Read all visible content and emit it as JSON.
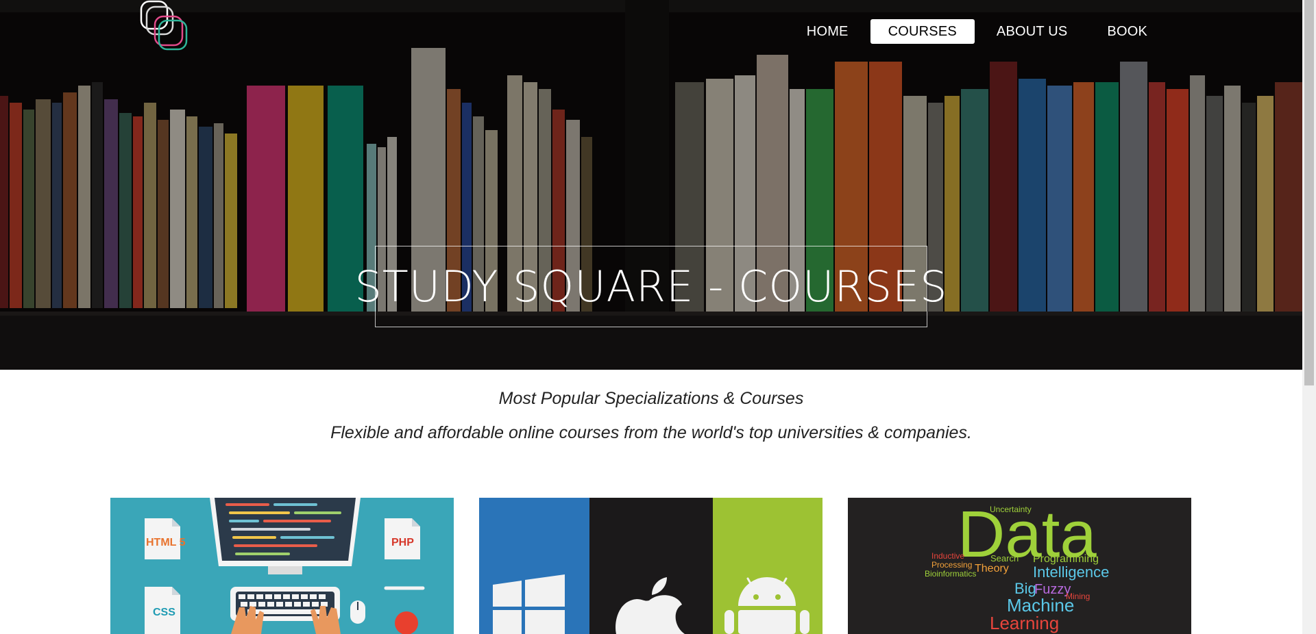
{
  "nav": {
    "items": [
      {
        "label": "HOME",
        "active": false
      },
      {
        "label": "COURSES",
        "active": true
      },
      {
        "label": "ABOUT US",
        "active": false
      },
      {
        "label": "BOOK",
        "active": false
      }
    ]
  },
  "hero": {
    "title": "STUDY SQUARE - COURSES"
  },
  "intro": {
    "line1": "Most Popular Specializations & Courses",
    "line2": "Flexible and affordable online courses from the world's top universities & companies."
  },
  "cards": {
    "web": {
      "labels": [
        "HTML 5",
        "PHP",
        "CSS"
      ]
    },
    "data": {
      "big_word": "Data",
      "words": [
        "Uncertainty",
        "Inductive",
        "Processing",
        "Bioinformatics",
        "Search",
        "Theory",
        "Programming",
        "Intelligence",
        "Big",
        "Fuzzy",
        "Mining",
        "Machine",
        "Learning"
      ]
    }
  },
  "colors": {
    "nav_active_bg": "#ffffff",
    "card_web_bg": "#3aa6b8",
    "windows_blue": "#2a74b8",
    "android_green": "#9dc233",
    "data_green": "#9fd13a"
  }
}
